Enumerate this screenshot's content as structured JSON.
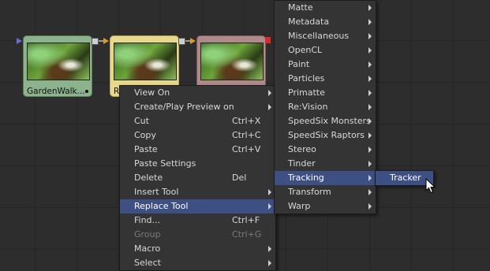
{
  "nodes": [
    {
      "label": "GardenWalk..."
    },
    {
      "label": "R"
    },
    {
      "label": ""
    }
  ],
  "context_menu": [
    {
      "label": "View On",
      "shortcut": "",
      "submenu": true,
      "state": "normal"
    },
    {
      "label": "Create/Play Preview on",
      "shortcut": "",
      "submenu": true,
      "state": "normal"
    },
    {
      "label": "Cut",
      "shortcut": "Ctrl+X",
      "submenu": false,
      "state": "normal"
    },
    {
      "label": "Copy",
      "shortcut": "Ctrl+C",
      "submenu": false,
      "state": "normal"
    },
    {
      "label": "Paste",
      "shortcut": "Ctrl+V",
      "submenu": false,
      "state": "normal"
    },
    {
      "label": "Paste Settings",
      "shortcut": "",
      "submenu": false,
      "state": "normal"
    },
    {
      "label": "Delete",
      "shortcut": "Del",
      "submenu": false,
      "state": "normal"
    },
    {
      "label": "Insert Tool",
      "shortcut": "",
      "submenu": true,
      "state": "normal"
    },
    {
      "label": "Replace Tool",
      "shortcut": "",
      "submenu": true,
      "state": "highlighted"
    },
    {
      "label": "Find...",
      "shortcut": "Ctrl+F",
      "submenu": false,
      "state": "normal"
    },
    {
      "label": "Group",
      "shortcut": "Ctrl+G",
      "submenu": false,
      "state": "disabled"
    },
    {
      "label": "Macro",
      "shortcut": "",
      "submenu": true,
      "state": "normal"
    },
    {
      "label": "Select",
      "shortcut": "",
      "submenu": true,
      "state": "normal"
    }
  ],
  "replace_tool_submenu": [
    {
      "label": "Matte",
      "state": "normal"
    },
    {
      "label": "Metadata",
      "state": "normal"
    },
    {
      "label": "Miscellaneous",
      "state": "normal"
    },
    {
      "label": "OpenCL",
      "state": "normal"
    },
    {
      "label": "Paint",
      "state": "normal"
    },
    {
      "label": "Particles",
      "state": "normal"
    },
    {
      "label": "Primatte",
      "state": "normal"
    },
    {
      "label": "Re:Vision",
      "state": "normal"
    },
    {
      "label": "SpeedSix Monsters",
      "state": "normal"
    },
    {
      "label": "SpeedSix Raptors",
      "state": "normal"
    },
    {
      "label": "Stereo",
      "state": "normal"
    },
    {
      "label": "Tinder",
      "state": "normal"
    },
    {
      "label": "Tracking",
      "state": "highlighted"
    },
    {
      "label": "Transform",
      "state": "normal"
    },
    {
      "label": "Warp",
      "state": "normal"
    }
  ],
  "tracking_submenu": [
    {
      "label": "Tracker",
      "state": "highlighted"
    }
  ],
  "colors": {
    "menu_highlight": "#3e4f84",
    "node_loader": "#8db38e",
    "node_selected": "#e8d88c",
    "node_third": "#b08a8a"
  },
  "icons": {
    "cursor": "mouse-pointer-icon",
    "submenu": "triangle-right-icon"
  }
}
